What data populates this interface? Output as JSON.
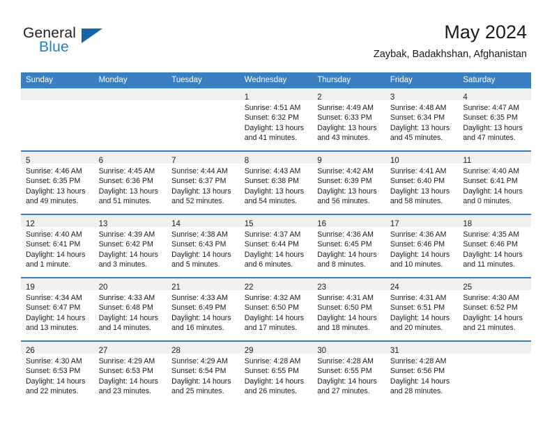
{
  "logo": {
    "primary_text": "General",
    "secondary_text": "Blue",
    "primary_color": "#231f20",
    "secondary_color": "#1f7ec4",
    "triangle_color": "#1565a8"
  },
  "header": {
    "title": "May 2024",
    "subtitle": "Zaybak, Badakhshan, Afghanistan"
  },
  "theme": {
    "header_row_bg": "#3a7fc1",
    "header_row_text": "#ffffff",
    "daynum_band_bg": "#f0f0f0",
    "cell_divider": "#3a7fc1",
    "text_color": "#1a1a1a"
  },
  "weekday_headers": [
    "Sunday",
    "Monday",
    "Tuesday",
    "Wednesday",
    "Thursday",
    "Friday",
    "Saturday"
  ],
  "weeks": [
    [
      {
        "day": "",
        "empty": true,
        "lines": []
      },
      {
        "day": "",
        "empty": true,
        "lines": []
      },
      {
        "day": "",
        "empty": true,
        "lines": []
      },
      {
        "day": "1",
        "empty": false,
        "lines": [
          "Sunrise: 4:51 AM",
          "Sunset: 6:32 PM",
          "Daylight: 13 hours",
          "and 41 minutes."
        ]
      },
      {
        "day": "2",
        "empty": false,
        "lines": [
          "Sunrise: 4:49 AM",
          "Sunset: 6:33 PM",
          "Daylight: 13 hours",
          "and 43 minutes."
        ]
      },
      {
        "day": "3",
        "empty": false,
        "lines": [
          "Sunrise: 4:48 AM",
          "Sunset: 6:34 PM",
          "Daylight: 13 hours",
          "and 45 minutes."
        ]
      },
      {
        "day": "4",
        "empty": false,
        "lines": [
          "Sunrise: 4:47 AM",
          "Sunset: 6:35 PM",
          "Daylight: 13 hours",
          "and 47 minutes."
        ]
      }
    ],
    [
      {
        "day": "5",
        "empty": false,
        "lines": [
          "Sunrise: 4:46 AM",
          "Sunset: 6:35 PM",
          "Daylight: 13 hours",
          "and 49 minutes."
        ]
      },
      {
        "day": "6",
        "empty": false,
        "lines": [
          "Sunrise: 4:45 AM",
          "Sunset: 6:36 PM",
          "Daylight: 13 hours",
          "and 51 minutes."
        ]
      },
      {
        "day": "7",
        "empty": false,
        "lines": [
          "Sunrise: 4:44 AM",
          "Sunset: 6:37 PM",
          "Daylight: 13 hours",
          "and 52 minutes."
        ]
      },
      {
        "day": "8",
        "empty": false,
        "lines": [
          "Sunrise: 4:43 AM",
          "Sunset: 6:38 PM",
          "Daylight: 13 hours",
          "and 54 minutes."
        ]
      },
      {
        "day": "9",
        "empty": false,
        "lines": [
          "Sunrise: 4:42 AM",
          "Sunset: 6:39 PM",
          "Daylight: 13 hours",
          "and 56 minutes."
        ]
      },
      {
        "day": "10",
        "empty": false,
        "lines": [
          "Sunrise: 4:41 AM",
          "Sunset: 6:40 PM",
          "Daylight: 13 hours",
          "and 58 minutes."
        ]
      },
      {
        "day": "11",
        "empty": false,
        "lines": [
          "Sunrise: 4:40 AM",
          "Sunset: 6:41 PM",
          "Daylight: 14 hours",
          "and 0 minutes."
        ]
      }
    ],
    [
      {
        "day": "12",
        "empty": false,
        "lines": [
          "Sunrise: 4:40 AM",
          "Sunset: 6:41 PM",
          "Daylight: 14 hours",
          "and 1 minute."
        ]
      },
      {
        "day": "13",
        "empty": false,
        "lines": [
          "Sunrise: 4:39 AM",
          "Sunset: 6:42 PM",
          "Daylight: 14 hours",
          "and 3 minutes."
        ]
      },
      {
        "day": "14",
        "empty": false,
        "lines": [
          "Sunrise: 4:38 AM",
          "Sunset: 6:43 PM",
          "Daylight: 14 hours",
          "and 5 minutes."
        ]
      },
      {
        "day": "15",
        "empty": false,
        "lines": [
          "Sunrise: 4:37 AM",
          "Sunset: 6:44 PM",
          "Daylight: 14 hours",
          "and 6 minutes."
        ]
      },
      {
        "day": "16",
        "empty": false,
        "lines": [
          "Sunrise: 4:36 AM",
          "Sunset: 6:45 PM",
          "Daylight: 14 hours",
          "and 8 minutes."
        ]
      },
      {
        "day": "17",
        "empty": false,
        "lines": [
          "Sunrise: 4:36 AM",
          "Sunset: 6:46 PM",
          "Daylight: 14 hours",
          "and 10 minutes."
        ]
      },
      {
        "day": "18",
        "empty": false,
        "lines": [
          "Sunrise: 4:35 AM",
          "Sunset: 6:46 PM",
          "Daylight: 14 hours",
          "and 11 minutes."
        ]
      }
    ],
    [
      {
        "day": "19",
        "empty": false,
        "lines": [
          "Sunrise: 4:34 AM",
          "Sunset: 6:47 PM",
          "Daylight: 14 hours",
          "and 13 minutes."
        ]
      },
      {
        "day": "20",
        "empty": false,
        "lines": [
          "Sunrise: 4:33 AM",
          "Sunset: 6:48 PM",
          "Daylight: 14 hours",
          "and 14 minutes."
        ]
      },
      {
        "day": "21",
        "empty": false,
        "lines": [
          "Sunrise: 4:33 AM",
          "Sunset: 6:49 PM",
          "Daylight: 14 hours",
          "and 16 minutes."
        ]
      },
      {
        "day": "22",
        "empty": false,
        "lines": [
          "Sunrise: 4:32 AM",
          "Sunset: 6:50 PM",
          "Daylight: 14 hours",
          "and 17 minutes."
        ]
      },
      {
        "day": "23",
        "empty": false,
        "lines": [
          "Sunrise: 4:31 AM",
          "Sunset: 6:50 PM",
          "Daylight: 14 hours",
          "and 18 minutes."
        ]
      },
      {
        "day": "24",
        "empty": false,
        "lines": [
          "Sunrise: 4:31 AM",
          "Sunset: 6:51 PM",
          "Daylight: 14 hours",
          "and 20 minutes."
        ]
      },
      {
        "day": "25",
        "empty": false,
        "lines": [
          "Sunrise: 4:30 AM",
          "Sunset: 6:52 PM",
          "Daylight: 14 hours",
          "and 21 minutes."
        ]
      }
    ],
    [
      {
        "day": "26",
        "empty": false,
        "lines": [
          "Sunrise: 4:30 AM",
          "Sunset: 6:53 PM",
          "Daylight: 14 hours",
          "and 22 minutes."
        ]
      },
      {
        "day": "27",
        "empty": false,
        "lines": [
          "Sunrise: 4:29 AM",
          "Sunset: 6:53 PM",
          "Daylight: 14 hours",
          "and 23 minutes."
        ]
      },
      {
        "day": "28",
        "empty": false,
        "lines": [
          "Sunrise: 4:29 AM",
          "Sunset: 6:54 PM",
          "Daylight: 14 hours",
          "and 25 minutes."
        ]
      },
      {
        "day": "29",
        "empty": false,
        "lines": [
          "Sunrise: 4:28 AM",
          "Sunset: 6:55 PM",
          "Daylight: 14 hours",
          "and 26 minutes."
        ]
      },
      {
        "day": "30",
        "empty": false,
        "lines": [
          "Sunrise: 4:28 AM",
          "Sunset: 6:55 PM",
          "Daylight: 14 hours",
          "and 27 minutes."
        ]
      },
      {
        "day": "31",
        "empty": false,
        "lines": [
          "Sunrise: 4:28 AM",
          "Sunset: 6:56 PM",
          "Daylight: 14 hours",
          "and 28 minutes."
        ]
      },
      {
        "day": "",
        "empty": true,
        "lines": []
      }
    ]
  ]
}
